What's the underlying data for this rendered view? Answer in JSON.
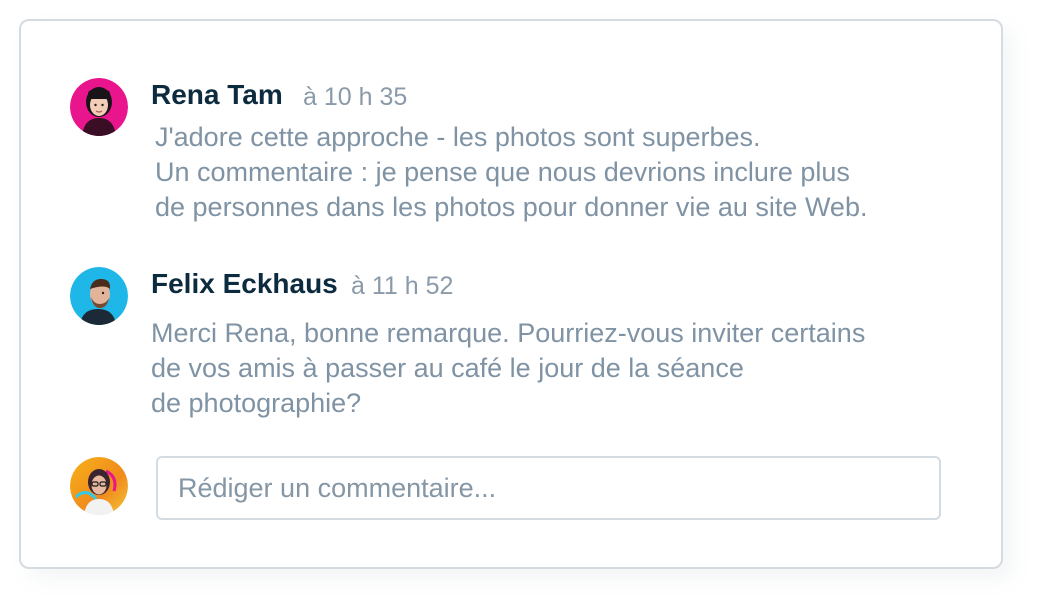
{
  "comments": [
    {
      "author": "Rena Tam",
      "time": "à 10 h 35",
      "avatar_icon": "rena-tam-avatar",
      "lines": [
        "J'adore cette approche - les photos sont superbes.",
        "Un commentaire : je pense que nous devrions inclure plus",
        "de personnes dans les photos pour donner vie au site Web."
      ]
    },
    {
      "author": "Felix Eckhaus",
      "time": "à 11 h 52",
      "avatar_icon": "felix-eckhaus-avatar",
      "lines": [
        "Merci Rena, bonne remarque. Pourriez-vous inviter certains",
        "de vos amis à passer au café le jour de la séance",
        "de photographie?"
      ]
    }
  ],
  "composer": {
    "placeholder": "Rédiger un commentaire...",
    "value": "",
    "avatar_icon": "current-user-avatar"
  },
  "colors": {
    "name": "#0d2b3e",
    "text": "#7f93a4",
    "meta": "#8a9aa8",
    "border": "#d4dce2"
  }
}
